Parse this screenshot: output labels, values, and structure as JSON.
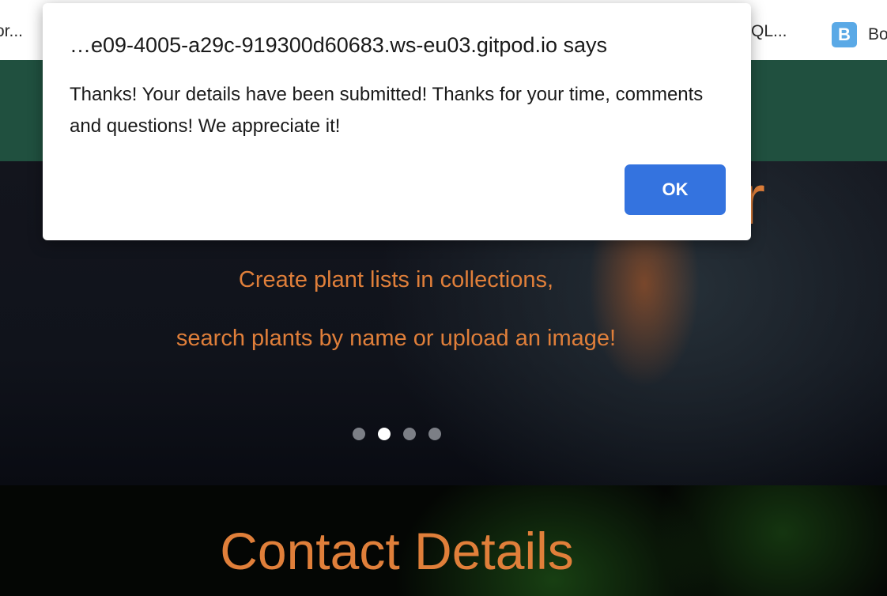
{
  "bookmarks": {
    "left_label": "or...",
    "mid_label": "QL...",
    "right_icon_letter": "B",
    "right_label": "Bo"
  },
  "hero": {
    "title_fragment": "r",
    "line1": "Create plant lists in collections,",
    "line2": "search plants by name or upload an image!",
    "active_slide": 2,
    "slide_count": 4
  },
  "contact": {
    "title": "Contact Details"
  },
  "alert": {
    "origin": "…e09-4005-a29c-919300d60683.ws-eu03.gitpod.io says",
    "message": "Thanks! Your details have been submitted! Thanks for your time, comments and questions! We appreciate it!",
    "ok_label": "OK"
  },
  "colors": {
    "accent_orange": "#e07f3a",
    "navbar_green": "#20503f",
    "ok_blue": "#3473df"
  }
}
